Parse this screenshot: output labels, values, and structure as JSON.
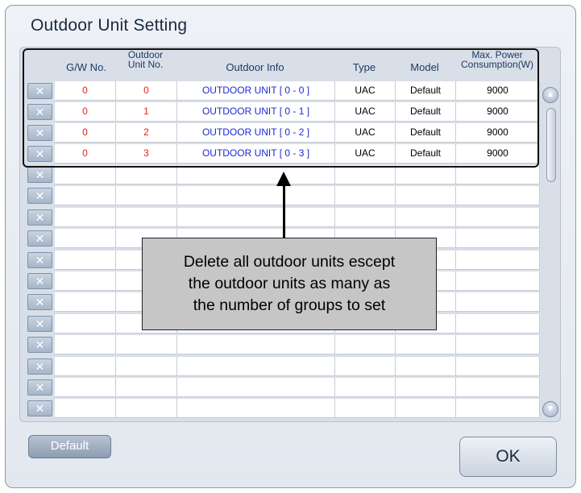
{
  "window": {
    "title": "Outdoor Unit Setting"
  },
  "table": {
    "headers": {
      "gw_no": "G/W No.",
      "outdoor_unit_no_line1": "Outdoor",
      "outdoor_unit_no_line2": "Unit No.",
      "outdoor_info": "Outdoor Info",
      "type": "Type",
      "model": "Model",
      "max_power_line1": "Max. Power",
      "max_power_line2": "Consumption(W)"
    },
    "delete_glyph": "✕",
    "rows": [
      {
        "gw": "0",
        "unit": "0",
        "info": "OUTDOOR UNIT [ 0 - 0 ]",
        "type": "UAC",
        "model": "Default",
        "power": "9000"
      },
      {
        "gw": "0",
        "unit": "1",
        "info": "OUTDOOR UNIT [ 0 - 1 ]",
        "type": "UAC",
        "model": "Default",
        "power": "9000"
      },
      {
        "gw": "0",
        "unit": "2",
        "info": "OUTDOOR UNIT [ 0 - 2 ]",
        "type": "UAC",
        "model": "Default",
        "power": "9000"
      },
      {
        "gw": "0",
        "unit": "3",
        "info": "OUTDOOR UNIT [ 0 - 3 ]",
        "type": "UAC",
        "model": "Default",
        "power": "9000"
      }
    ],
    "empty_row_count": 12
  },
  "callout": {
    "lines": [
      "Delete all outdoor units escept",
      "the outdoor units as many as",
      "the number of groups to set"
    ]
  },
  "buttons": {
    "default_label": "Default",
    "ok_label": "OK"
  },
  "scrollbar": {
    "up_glyph": "▲",
    "down_glyph": "▼"
  },
  "colors": {
    "unit_number": "#e2231a",
    "outdoor_info": "#1b2ad6",
    "header_text": "#1d3a66"
  }
}
